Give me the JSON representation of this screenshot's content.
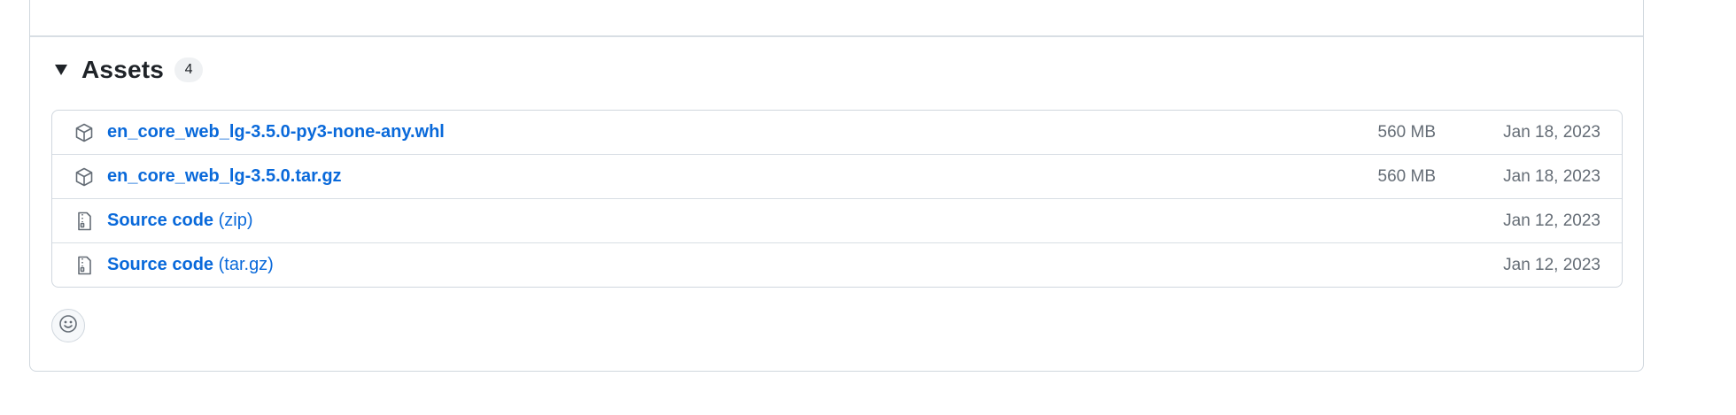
{
  "assets": {
    "title": "Assets",
    "count": "4",
    "items": [
      {
        "name": "en_core_web_lg-3.5.0-py3-none-any.whl",
        "suffix": "",
        "size": "560 MB",
        "date": "Jan 18, 2023",
        "icon": "package-icon"
      },
      {
        "name": "en_core_web_lg-3.5.0.tar.gz",
        "suffix": "",
        "size": "560 MB",
        "date": "Jan 18, 2023",
        "icon": "package-icon"
      },
      {
        "name": "Source code",
        "suffix": "(zip)",
        "size": "",
        "date": "Jan 12, 2023",
        "icon": "file-zip-icon"
      },
      {
        "name": "Source code",
        "suffix": "(tar.gz)",
        "size": "",
        "date": "Jan 12, 2023",
        "icon": "file-zip-icon"
      }
    ]
  },
  "reactions": {
    "icon": "smiley-icon"
  },
  "colors": {
    "link": "#0969da",
    "muted": "#656d76",
    "border": "#d0d7de"
  }
}
